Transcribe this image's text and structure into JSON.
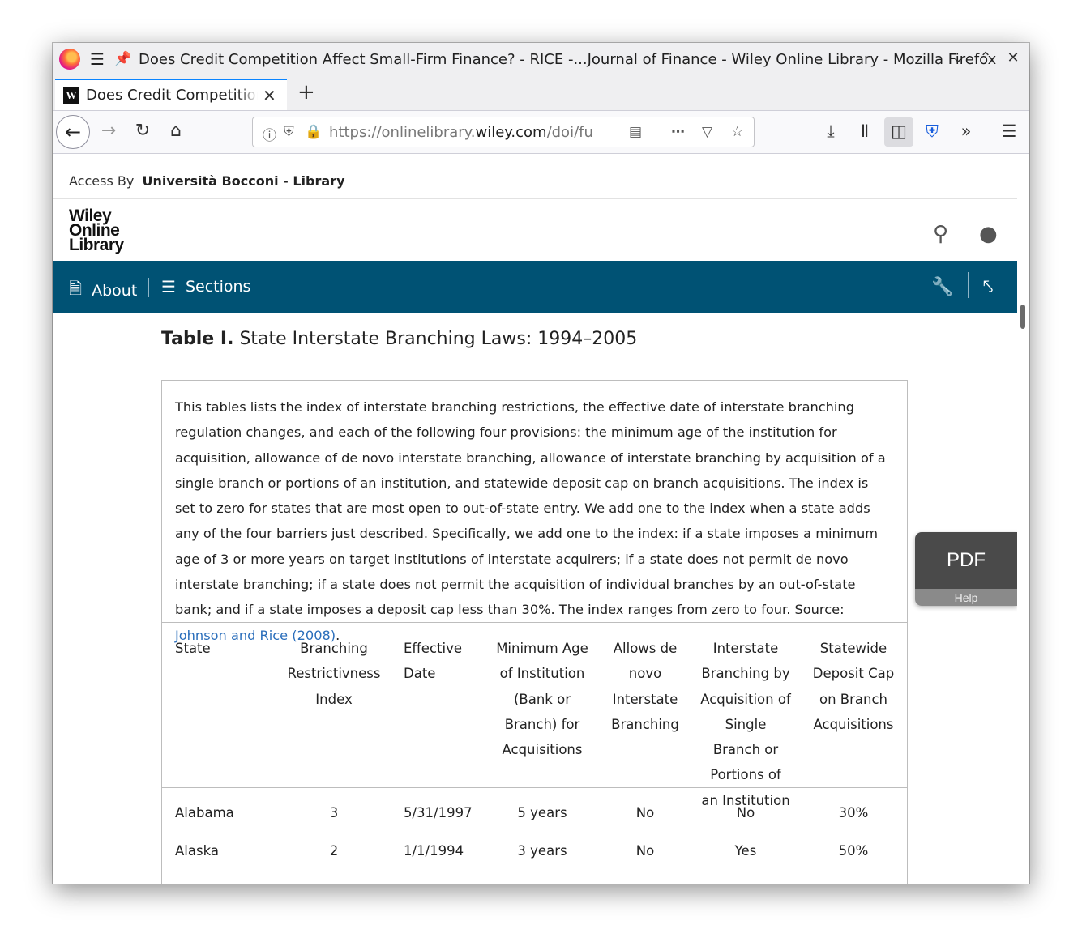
{
  "window": {
    "title": "Does Credit Competition Affect Small-Firm Finance? - RICE -...Journal of Finance - Wiley Online Library - Mozilla Firefox",
    "tab_title": "Does Credit Competition Affect Small-Firm Finance?",
    "tab_favicon": "W",
    "url_prefix": "https://onlinelibrary.",
    "url_domain": "wiley.com",
    "url_rest": "/doi/full"
  },
  "page": {
    "access_label": "Access By",
    "access_institution": "Università Bocconi - Library",
    "logo_lines": [
      "Wiley",
      "Online",
      "Library"
    ],
    "nav": {
      "about": "About",
      "sections": "Sections"
    },
    "table_label": "Table I.",
    "table_title": "State Interstate Branching Laws: 1994–2005",
    "caption": "This tables lists the index of interstate branching restrictions, the effective date of interstate branching regulation changes, and each of the following four provisions: the minimum age of the institution for acquisition, allowance of de novo interstate branching, allowance of interstate branching by acquisition of a single branch or portions of an institution, and statewide deposit cap on branch acquisitions. The index is set to zero for states that are most open to out-of-state entry. We add one to the index when a state adds any of the four barriers just described. Specifically, we add one to the index: if a state imposes a minimum age of 3 or more years on target institutions of interstate acquirers; if a state does not permit de novo interstate branching; if a state does not permit the acquisition of individual branches by an out-of-state bank; and if a state imposes a deposit cap less than 30%. The index ranges from zero to four. Source: ",
    "caption_link": "Johnson and Rice (2008)",
    "caption_end": ".",
    "columns": [
      "State",
      "Branching Restrictivness Index",
      "Effective Date",
      "Minimum Age of Institution (Bank or Branch) for Acquisitions",
      "Allows de novo Interstate Branching",
      "Interstate Branching by Acquisition of Single Branch or Portions of an Institution",
      "Statewide Deposit Cap on Branch Acquisitions"
    ],
    "rows": [
      [
        "Alabama",
        "3",
        "5/31/1997",
        "5 years",
        "No",
        "No",
        "30%"
      ],
      [
        "Alaska",
        "2",
        "1/1/1994",
        "3 years",
        "No",
        "Yes",
        "50%"
      ]
    ],
    "pdf_label": "PDF",
    "help_label": "Help"
  }
}
